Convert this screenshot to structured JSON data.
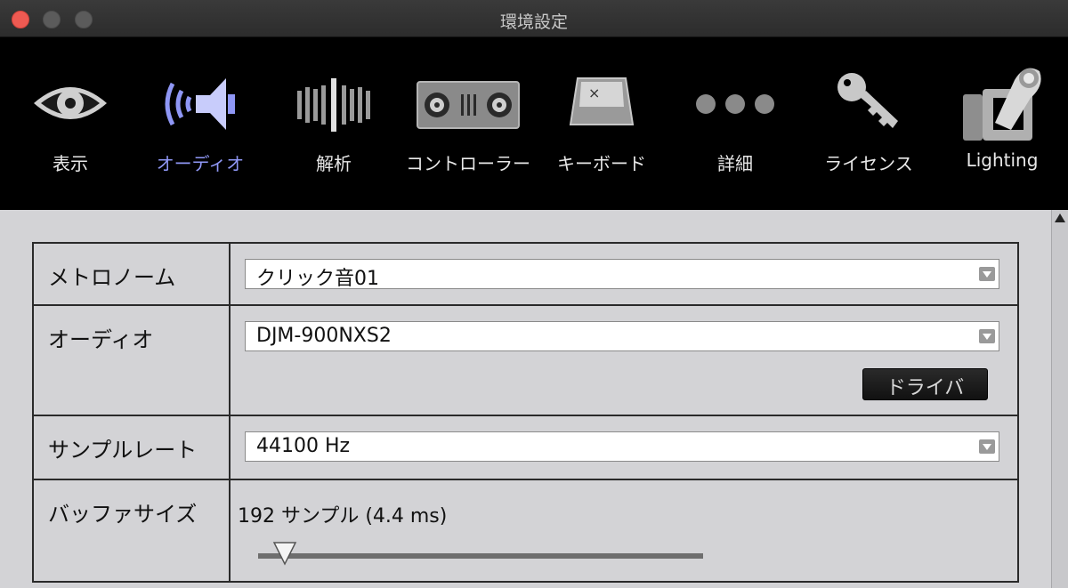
{
  "window": {
    "title": "環境設定"
  },
  "toolbar": {
    "items": [
      {
        "label": "表示",
        "icon": "eye-icon"
      },
      {
        "label": "オーディオ",
        "icon": "speaker-icon",
        "active": true
      },
      {
        "label": "解析",
        "icon": "waveform-icon"
      },
      {
        "label": "コントローラー",
        "icon": "controller-icon"
      },
      {
        "label": "キーボード",
        "icon": "keyboard-key-icon"
      },
      {
        "label": "詳細",
        "icon": "more-dots-icon"
      },
      {
        "label": "ライセンス",
        "icon": "key-icon"
      },
      {
        "label": "Lighting",
        "icon": "moving-head-light-icon"
      }
    ],
    "active_color": "#8f97f5"
  },
  "settings": {
    "metronome": {
      "label": "メトロノーム",
      "value": "クリック音01"
    },
    "audio": {
      "label": "オーディオ",
      "value": "DJM-900NXS2",
      "driver_button": "ドライバ"
    },
    "sample_rate": {
      "label": "サンプルレート",
      "value": "44100 Hz"
    },
    "buffer_size": {
      "label": "バッファサイズ",
      "value_text": "192 サンプル (4.4 ms)",
      "slider_position": 0.06
    }
  }
}
